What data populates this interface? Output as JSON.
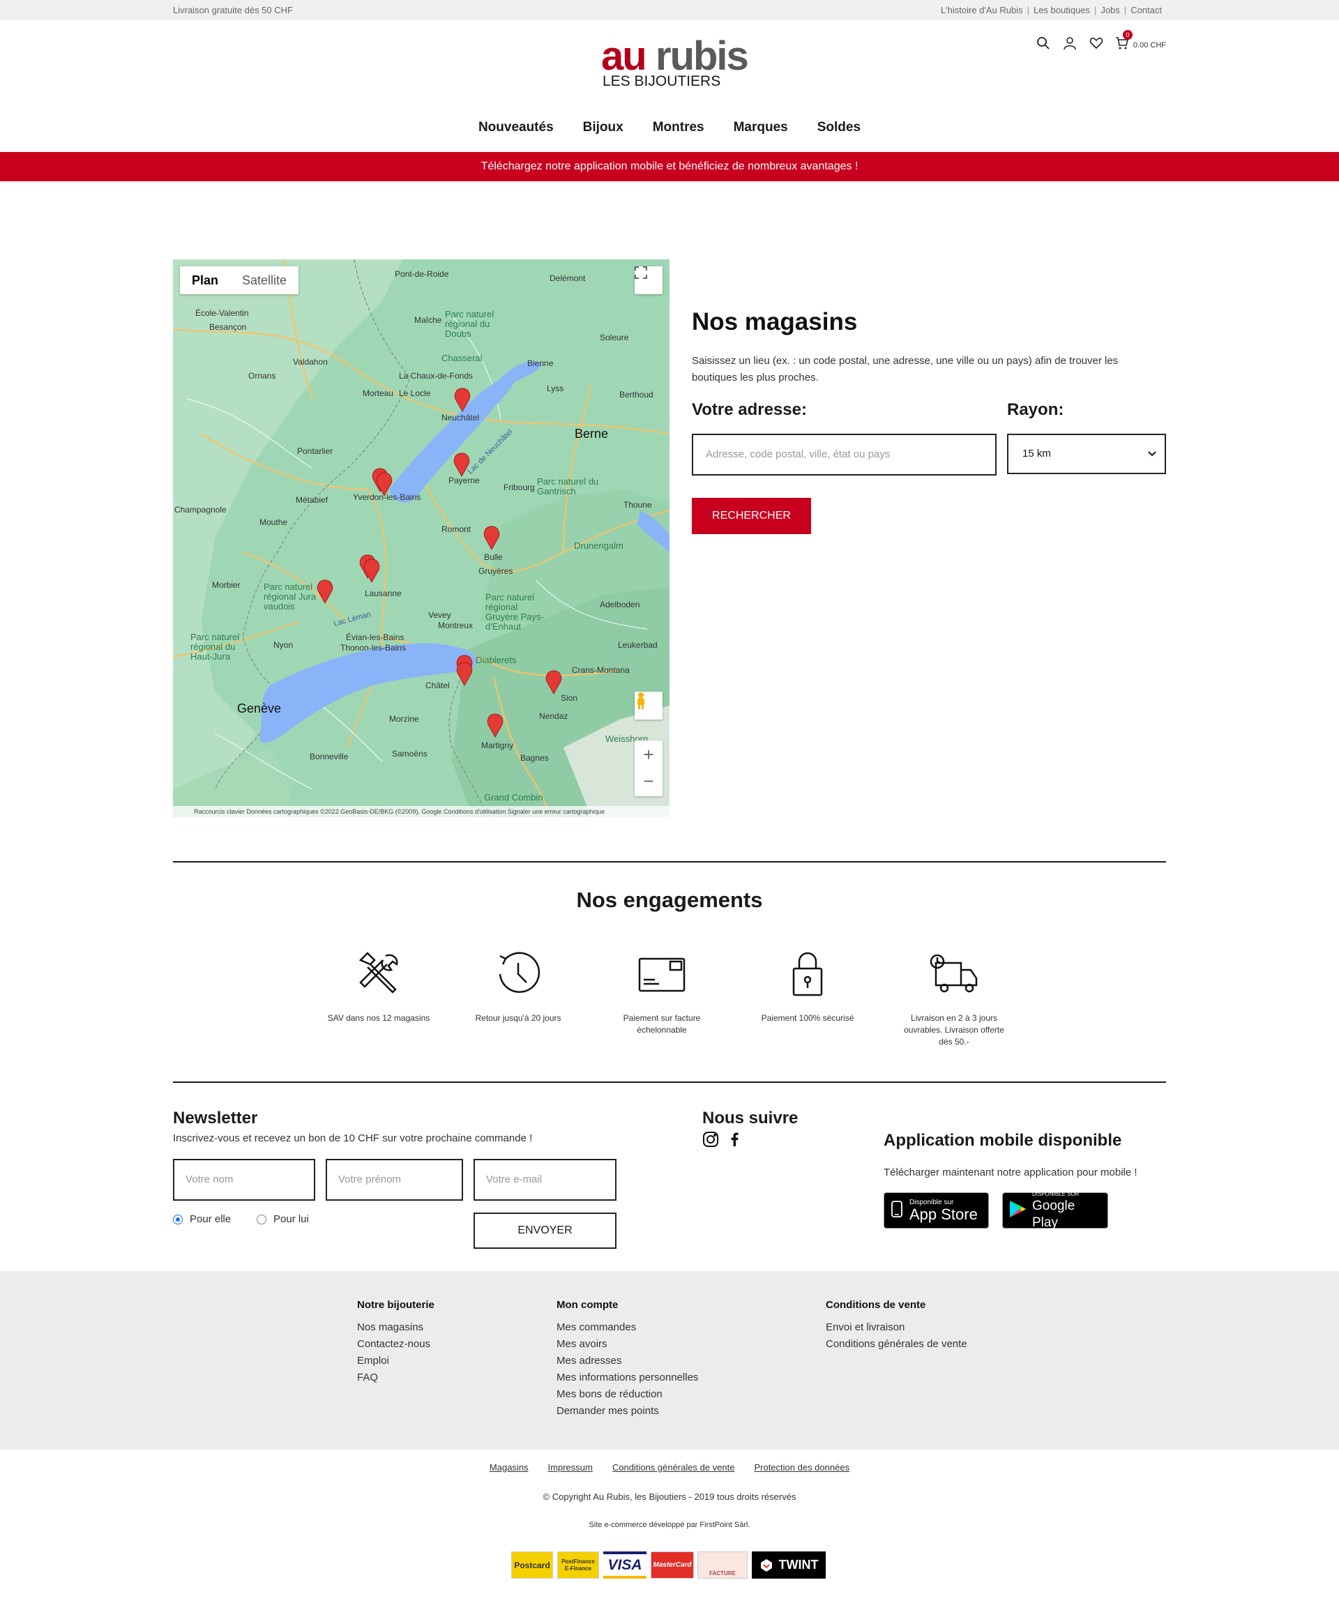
{
  "topbar": {
    "left": "Livraison gratuite dès 50 CHF",
    "links": [
      "L'histoire d'Au Rubis",
      "Les boutiques",
      "Jobs",
      "Contact"
    ]
  },
  "logo": {
    "au": "au",
    "rubis": "rubis",
    "sub": "LES BIJOUTIERS"
  },
  "cart": {
    "count": "0",
    "amount": "0.00 CHF"
  },
  "nav": [
    "Nouveautés",
    "Bijoux",
    "Montres",
    "Marques",
    "Soldes"
  ],
  "promo": "Téléchargez notre application mobile et bénéficiez de nombreux avantages !",
  "map": {
    "tabs": [
      "Plan",
      "Satellite"
    ],
    "attribution": "Raccourcis clavier    Données cartographiques ©2022 GeoBasis-DE/BKG (©2009), Google    Conditions d'utilisation    Signaler une erreur cartographique",
    "labels": {
      "berne": "Berne",
      "geneve": "Genève",
      "lausanne": "Lausanne",
      "neuchatel": "Neuchâtel",
      "yverdon": "Yverdon-les-Bains",
      "payerne": "Payerne",
      "bulle": "Bulle",
      "sion": "Sion",
      "martigny": "Martigny",
      "besancon": "Besançon",
      "lac_leman": "Lac Léman",
      "lac_neuchatel": "Lac de Neuchâtel",
      "fribourg": "Fribourg",
      "thoune": "Thoune",
      "montreux": "Montreux",
      "vevey": "Vevey",
      "evian": "Évian-les-Bains",
      "thonon": "Thonon-les-Bains",
      "nyon": "Nyon",
      "chatel": "Châtel",
      "morzine": "Morzine",
      "samoens": "Samoëns",
      "bonneville": "Bonneville",
      "pontarlier": "Pontarlier",
      "metabief": "Métabief",
      "mouthe": "Mouthe",
      "morbier": "Morbier",
      "champagnole": "Champagnole",
      "ornans": "Ornans",
      "valdahon": "Valdahon",
      "maiche": "Maîche",
      "la_chaux": "La Chaux-de-Fonds",
      "le_locle": "Le Locle",
      "morteau": "Morteau",
      "bienne": "Bienne",
      "lyss": "Lyss",
      "soleure": "Soleure",
      "romont": "Romont",
      "gruyeres": "Gruyères",
      "adelboden": "Adelboden",
      "leukerbad": "Leukerbad",
      "crans": "Crans-Montana",
      "nendaz": "Nendaz",
      "bagnes": "Bagnes",
      "delemont": "Delémont",
      "pont_de_roide": "Pont-de-Roide",
      "chasseral": "Chasseral",
      "diablerets": "Diablerets",
      "drunengalm": "Drunengalm",
      "weisshorn": "Weisshorn",
      "grand_combin": "Grand Combin",
      "berthoud": "Berthoud",
      "ecole_valentin": "École-Valentin"
    },
    "parks": [
      "Parc naturel régional du Doubs",
      "Parc naturel régional Jura vaudois",
      "Parc naturel régional Gruyère Pays-d'Enhaut",
      "Parc naturel du Gantrisch",
      "Parc naturel régional du Haut-Jura"
    ]
  },
  "stores": {
    "title": "Nos magasins",
    "description": "Saisissez un lieu (ex. : un code postal, une adresse, une ville ou un pays) afin de trouver les boutiques les plus proches.",
    "address_label": "Votre adresse:",
    "address_placeholder": "Adresse, code postal, ville, état ou pays",
    "radius_label": "Rayon:",
    "radius_value": "15 km",
    "search_button": "RECHERCHER"
  },
  "engagements": {
    "title": "Nos engagements",
    "items": [
      {
        "icon": "tools-icon",
        "text": "SAV dans nos 12 magasins"
      },
      {
        "icon": "return-clock-icon",
        "text": "Retour jusqu'à 20 jours"
      },
      {
        "icon": "invoice-card-icon",
        "text": "Paiement sur facture échelonnable"
      },
      {
        "icon": "padlock-icon",
        "text": "Paiement 100% sécurisé"
      },
      {
        "icon": "delivery-truck-icon",
        "text": "Livraison en 2 à 3 jours ouvrables. Livraison offerte dès 50.-"
      }
    ]
  },
  "newsletter": {
    "title": "Newsletter",
    "subtitle": "Inscrivez-vous et recevez un bon de 10 CHF sur votre prochaine commande !",
    "name_placeholder": "Votre nom",
    "firstname_placeholder": "Votre prénom",
    "email_placeholder": "Votre e-mail",
    "radio_her": "Pour elle",
    "radio_him": "Pour lui",
    "submit": "ENVOYER"
  },
  "follow": {
    "title": "Nous suivre"
  },
  "app": {
    "title": "Application mobile disponible",
    "subtitle": "Télécharger maintenant notre application pour mobile !",
    "appstore_small": "Disponible sur",
    "appstore_big": "App Store",
    "play_small": "DISPONIBLE SUR",
    "play_big": "Google Play"
  },
  "footer": {
    "col1": {
      "title": "Notre bijouterie",
      "items": [
        "Nos magasins",
        "Contactez-nous",
        "Emploi",
        "FAQ"
      ]
    },
    "col2": {
      "title": "Mon compte",
      "items": [
        "Mes commandes",
        "Mes avoirs",
        "Mes adresses",
        "Mes informations personnelles",
        "Mes bons de réduction",
        "Demander mes points"
      ]
    },
    "col3": {
      "title": "Conditions de vente",
      "items": [
        "Envoi et livraison",
        "Conditions générales de vente"
      ]
    }
  },
  "legal": [
    "Magasins",
    "Impressum",
    "Conditions générales de vente",
    "Protection des données"
  ],
  "copyright": "© Copyright Au Rubis, les Bijoutiers - 2019 tous droits réservés",
  "developer": "Site e-commerce développé par FirstPoint Sàrl.",
  "payments": [
    "Postcard",
    "PostFinance E-Finance",
    "VISA",
    "MasterCard",
    "FACTURE",
    "TWINT"
  ],
  "colors": {
    "accent": "#c8001e",
    "map_green": "#9fd7b4",
    "lake": "#8ab4f8"
  }
}
